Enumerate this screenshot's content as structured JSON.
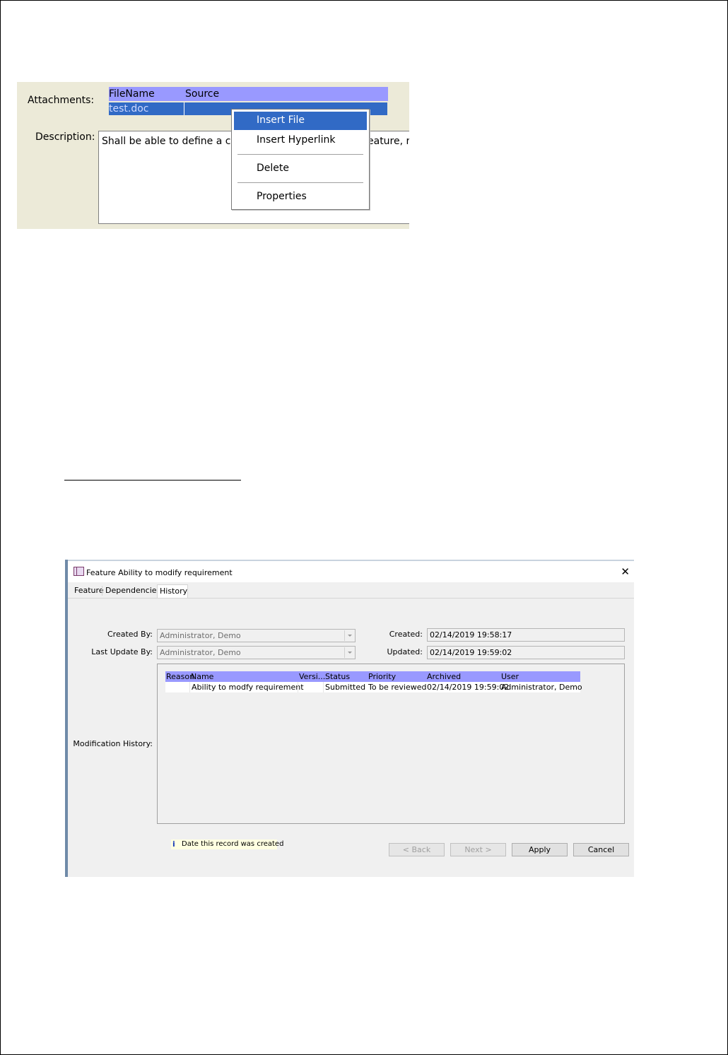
{
  "attachments_screenshot": {
    "attachments_label": "Attachments:",
    "description_label": "Description:",
    "table": {
      "columns": [
        "FileName",
        "Source"
      ],
      "rows": [
        {
          "file_name": "test.doc",
          "source": ""
        }
      ]
    },
    "description_visible_start": "Shall be able to define a cu",
    "description_visible_tail": "eature, r",
    "context_menu": {
      "items": [
        "Insert File",
        "Insert Hyperlink",
        "Delete",
        "Properties"
      ],
      "selected": "Insert File"
    }
  },
  "dialog": {
    "title": "Feature Ability to modify requirement",
    "close_glyph": "✕",
    "tabs": [
      "Feature",
      "Dependencies",
      "History"
    ],
    "active_tab": "History",
    "created_by_label": "Created By:",
    "created_by_value": "Administrator, Demo",
    "last_update_by_label": "Last Update By:",
    "last_update_by_value": "Administrator, Demo",
    "created_label": "Created:",
    "created_value": "02/14/2019 19:58:17",
    "updated_label": "Updated:",
    "updated_value": "02/14/2019 19:59:02",
    "modification_history_label": "Modification History:",
    "history_table": {
      "columns": [
        "Reason",
        "Name",
        "Versi...",
        "Status",
        "Priority",
        "Archived",
        "User"
      ],
      "rows": [
        {
          "reason": "",
          "name": "Ability to modfy requirement",
          "version": "",
          "status": "Submitted",
          "priority": "To be reviewed",
          "archived": "02/14/2019 19:59:02",
          "user": "Administrator, Demo"
        }
      ]
    },
    "hint_icon": "info-icon",
    "hint_text": "Date this record was created",
    "buttons": {
      "back": "< Back",
      "next": "Next >",
      "apply": "Apply",
      "cancel": "Cancel"
    },
    "colors": {
      "selection": "#316ac5",
      "table_header": "#9999ff",
      "hint_background": "#ffffe1"
    }
  }
}
